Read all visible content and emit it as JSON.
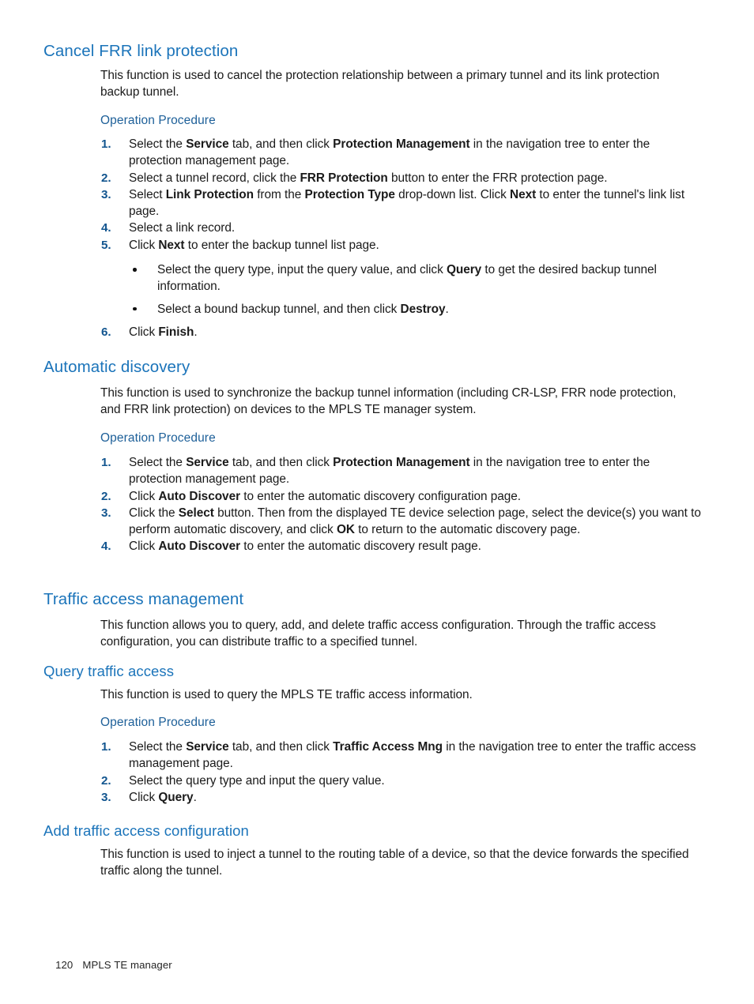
{
  "page": {
    "footer_page_number": "120",
    "footer_title": "MPLS TE manager",
    "heading_color": "#1b74ba",
    "subheading_color": "#1e6099",
    "list_number_color": "#12558f",
    "body_color": "#1a1a1a",
    "background_color": "#ffffff"
  },
  "sections": {
    "cancel_frr": {
      "title": "Cancel FRR link protection",
      "intro": "This function is used to cancel the protection relationship between a primary tunnel and its link protection backup tunnel.",
      "procedure_label": "Operation Procedure",
      "steps": {
        "s1_num": "1.",
        "s1_a": "Select the ",
        "s1_b1": "Service",
        "s1_c": " tab, and then click ",
        "s1_b2": "Protection Management",
        "s1_d": " in the navigation tree to enter the protection management page.",
        "s2_num": "2.",
        "s2_a": "Select a tunnel record, click the ",
        "s2_b1": "FRR Protection",
        "s2_c": " button to enter the FRR protection page.",
        "s3_num": "3.",
        "s3_a": "Select ",
        "s3_b1": "Link Protection",
        "s3_c": " from the ",
        "s3_b2": "Protection Type",
        "s3_d": " drop-down list. Click ",
        "s3_b3": "Next",
        "s3_e": " to enter the tunnel's link list page.",
        "s4_num": "4.",
        "s4_a": "Select a link record.",
        "s5_num": "5.",
        "s5_a": "Click ",
        "s5_b1": "Next",
        "s5_c": " to enter the backup tunnel list page.",
        "b1_a": "Select the query type, input the query value, and click ",
        "b1_b1": "Query",
        "b1_c": " to get the desired backup tunnel information.",
        "b2_a": "Select a bound backup tunnel, and then click ",
        "b2_b1": "Destroy",
        "b2_c": ".",
        "s6_num": "6.",
        "s6_a": "Click ",
        "s6_b1": "Finish",
        "s6_c": "."
      }
    },
    "automatic_discovery": {
      "title": "Automatic discovery",
      "intro": "This function is used to synchronize the backup tunnel information (including CR-LSP, FRR node protection, and FRR link protection) on devices to the MPLS TE manager system.",
      "procedure_label": "Operation Procedure",
      "steps": {
        "s1_num": "1.",
        "s1_a": "Select the ",
        "s1_b1": "Service",
        "s1_c": " tab, and then click ",
        "s1_b2": "Protection Management",
        "s1_d": " in the navigation tree to enter the protection management page.",
        "s2_num": "2.",
        "s2_a": "Click ",
        "s2_b1": "Auto Discover",
        "s2_c": " to enter the automatic discovery configuration page.",
        "s3_num": "3.",
        "s3_a": "Click the ",
        "s3_b1": "Select",
        "s3_c": " button. Then from the displayed TE device selection page, select the device(s) you want to perform automatic discovery, and click ",
        "s3_b2": "OK",
        "s3_d": " to return to the automatic discovery page.",
        "s4_num": "4.",
        "s4_a": "Click ",
        "s4_b1": "Auto Discover",
        "s4_c": " to enter the automatic discovery result page."
      }
    },
    "traffic_access_management": {
      "title": "Traffic access management",
      "intro": "This function allows you to query, add, and delete traffic access configuration. Through the traffic access configuration, you can distribute traffic to a specified tunnel."
    },
    "query_traffic_access": {
      "title": "Query traffic access",
      "intro": "This function is used to query the MPLS TE traffic access information.",
      "procedure_label": "Operation Procedure",
      "steps": {
        "s1_num": "1.",
        "s1_a": "Select the ",
        "s1_b1": "Service",
        "s1_c": " tab, and then click ",
        "s1_b2": "Traffic Access Mng",
        "s1_d": " in the navigation tree to enter the traffic access management page.",
        "s2_num": "2.",
        "s2_a": "Select the query type and input the query value.",
        "s3_num": "3.",
        "s3_a": "Click ",
        "s3_b1": "Query",
        "s3_c": "."
      }
    },
    "add_traffic_access_configuration": {
      "title": "Add traffic access configuration",
      "intro": "This function is used to inject a tunnel to the routing table of a device, so that the device forwards the specified traffic along the tunnel."
    }
  }
}
